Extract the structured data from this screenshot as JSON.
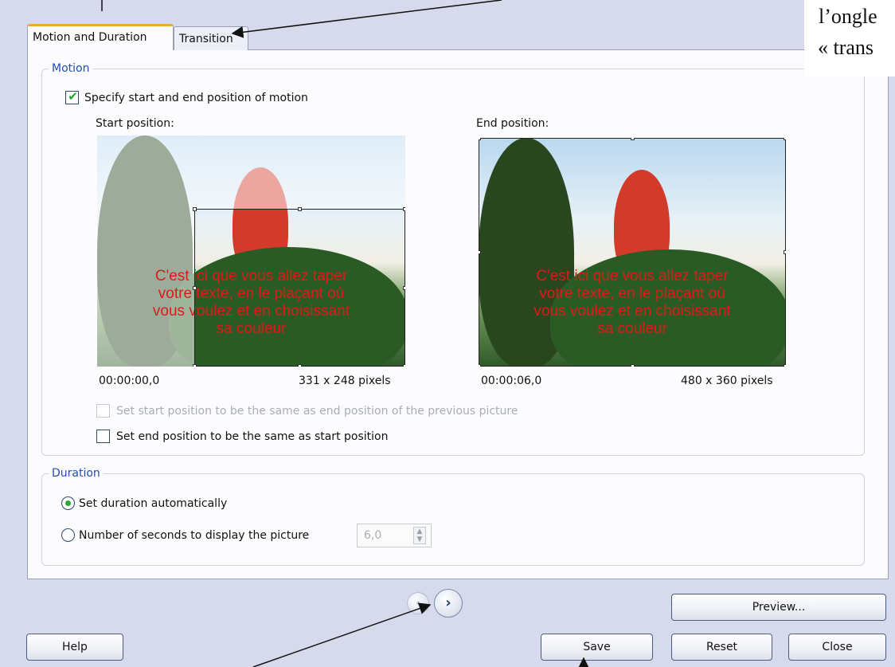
{
  "tabs": [
    {
      "label": "Motion and Duration",
      "selected": true
    },
    {
      "label": "Transition",
      "selected": false
    }
  ],
  "motion": {
    "group_title": "Motion",
    "specify_label": "Specify start and end position of motion",
    "specify_checked": true,
    "start": {
      "heading": "Start position:",
      "time": "00:00:00,0",
      "size": "331 x 248 pixels"
    },
    "end": {
      "heading": "End position:",
      "time": "00:00:06,0",
      "size": "480 x 360 pixels"
    },
    "overlay_text": "C'est ici que vous allez taper\nvotre texte, en le plaçant où\nvous voulez et en choisissant\nsa couleur",
    "same_as_prev_label": "Set start position to be the same as end position of the previous picture",
    "same_as_prev_enabled": false,
    "same_as_start_label": "Set end position to be the same as start position",
    "same_as_start_checked": false
  },
  "duration": {
    "group_title": "Duration",
    "auto_label": "Set duration automatically",
    "auto_selected": true,
    "seconds_label": "Number of seconds to display the picture",
    "seconds_value": "6,0"
  },
  "buttons": {
    "preview": "Preview...",
    "help": "Help",
    "save": "Save",
    "reset": "Reset",
    "close": "Close"
  },
  "nav": {
    "prev_icon": "chevron-left",
    "next_icon": "chevron-right"
  },
  "annotation": {
    "line1": "l’ongle",
    "line2": "« trans"
  },
  "colors": {
    "accent_tab": "#f0a83a",
    "group_title": "#1f4db0",
    "overlay_text": "#e01818",
    "dialog_bg": "#d7d9ec"
  }
}
